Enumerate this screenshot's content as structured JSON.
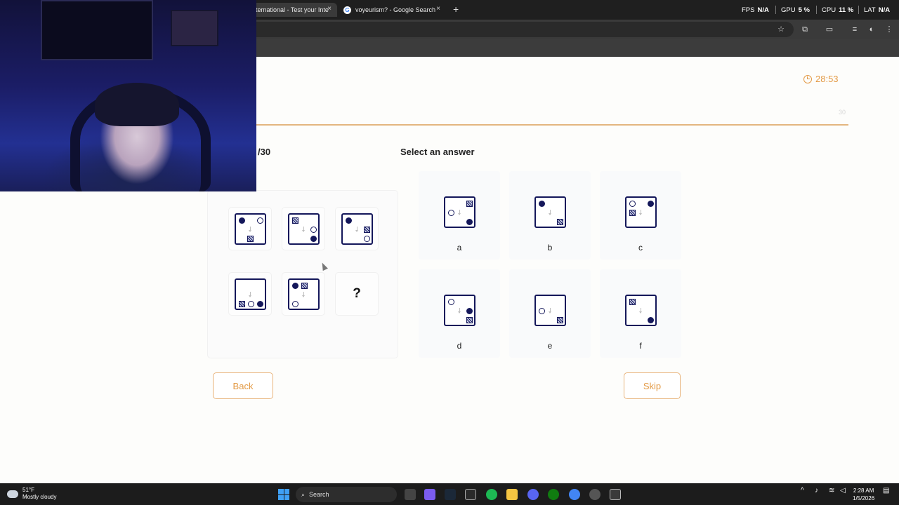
{
  "browser": {
    "tabs": [
      {
        "label": "ternational - Test your Inte",
        "active": true
      },
      {
        "label": "voyeurism? - Google Search",
        "active": false
      }
    ],
    "new_tab": "+",
    "close": "×",
    "perf": {
      "fps_label": "FPS",
      "fps_value": "N/A",
      "gpu_label": "GPU",
      "gpu_value": "5 %",
      "cpu_label": "CPU",
      "cpu_value": "11 %",
      "lat_label": "LAT",
      "lat_value": "N/A"
    }
  },
  "quiz": {
    "timer": "28:53",
    "progress_total": "30",
    "progress_fraction": 1.0,
    "question_count": "/30",
    "select_title": "Select an answer",
    "missing_cell": "?",
    "options": [
      "a",
      "b",
      "c",
      "d",
      "e",
      "f"
    ],
    "back_label": "Back",
    "skip_label": "Skip"
  },
  "taskbar": {
    "weather_temp": "51°F",
    "weather_desc": "Mostly cloudy",
    "search_label": "Search",
    "time": "2:28 AM",
    "date": "1/5/2026"
  },
  "colors": {
    "accent": "#e39a45",
    "figure": "#14175a",
    "progress": "#e3b67f"
  }
}
